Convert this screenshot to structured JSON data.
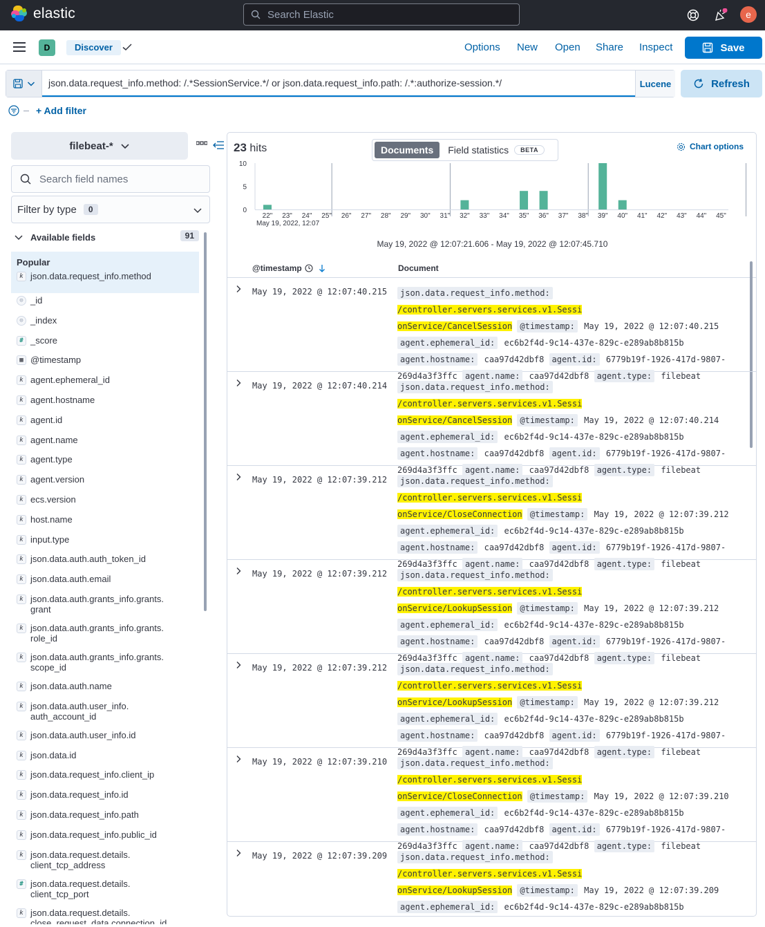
{
  "header": {
    "logo_text": "elastic",
    "search_placeholder": "Search Elastic",
    "avatar_letter": "e"
  },
  "appbar": {
    "space_letter": "D",
    "breadcrumb": "Discover",
    "menu": [
      "Options",
      "New",
      "Open",
      "Share",
      "Inspect"
    ],
    "save_label": "Save"
  },
  "query": {
    "value": "json.data.request_info.method: /.*SessionService.*/ or  json.data.request_info.path: /.*:authorize-session.*/",
    "language": "Lucene",
    "refresh_label": "Refresh",
    "add_filter_label": "+ Add filter"
  },
  "sidebar": {
    "index_pattern": "filebeat-*",
    "search_placeholder": "Search field names",
    "filter_by_type_label": "Filter by type",
    "filter_by_type_count": "0",
    "available_fields_label": "Available fields",
    "available_fields_count": "91",
    "popular_label": "Popular",
    "popular_fields": [
      {
        "type": "k",
        "name": "json.data.request_info.method"
      }
    ],
    "fields": [
      {
        "type": "id",
        "name": "_id"
      },
      {
        "type": "id",
        "name": "_index"
      },
      {
        "type": "#",
        "name": "_score"
      },
      {
        "type": "date",
        "name": "@timestamp"
      },
      {
        "type": "k",
        "name": "agent.ephemeral_id"
      },
      {
        "type": "k",
        "name": "agent.hostname"
      },
      {
        "type": "k",
        "name": "agent.id"
      },
      {
        "type": "k",
        "name": "agent.name"
      },
      {
        "type": "k",
        "name": "agent.type"
      },
      {
        "type": "k",
        "name": "agent.version"
      },
      {
        "type": "k",
        "name": "ecs.version"
      },
      {
        "type": "k",
        "name": "host.name"
      },
      {
        "type": "k",
        "name": "input.type"
      },
      {
        "type": "k",
        "name": "json.data.auth.auth_token_id"
      },
      {
        "type": "k",
        "name": "json.data.auth.email"
      },
      {
        "type": "k",
        "name": "json.data.auth.grants_info.grants.",
        "name2": "grant"
      },
      {
        "type": "k",
        "name": "json.data.auth.grants_info.grants.",
        "name2": "role_id"
      },
      {
        "type": "k",
        "name": "json.data.auth.grants_info.grants.",
        "name2": "scope_id"
      },
      {
        "type": "k",
        "name": "json.data.auth.name"
      },
      {
        "type": "k",
        "name": "json.data.auth.user_info.",
        "name2": "auth_account_id"
      },
      {
        "type": "k",
        "name": "json.data.auth.user_info.id"
      },
      {
        "type": "k",
        "name": "json.data.id"
      },
      {
        "type": "k",
        "name": "json.data.request_info.client_ip"
      },
      {
        "type": "k",
        "name": "json.data.request_info.id"
      },
      {
        "type": "k",
        "name": "json.data.request_info.path"
      },
      {
        "type": "k",
        "name": "json.data.request_info.public_id"
      },
      {
        "type": "k",
        "name": "json.data.request.details.",
        "name2": "client_tcp_address"
      },
      {
        "type": "#",
        "name": "json.data.request.details.",
        "name2": "client_tcp_port"
      },
      {
        "type": "k",
        "name": "json.data.request.details.",
        "name2": "close_request_data.connection_id"
      }
    ]
  },
  "main": {
    "hits_count": "23",
    "hits_label": "hits",
    "tabs": {
      "documents": "Documents",
      "field_statistics": "Field statistics",
      "beta": "BETA"
    },
    "chart_options_label": "Chart options",
    "time_range": "May 19, 2022 @ 12:07:21.606 - May 19, 2022 @ 12:07:45.710",
    "columns": {
      "timestamp": "@timestamp",
      "document": "Document"
    },
    "rows": [
      {
        "ts": "May 19, 2022 @ 12:07:40.215",
        "method_a": "/controller.servers.services.v1.Sessi",
        "method_b": "onService/CancelSession",
        "ts2": "May 19, 2022 @ 12:07:40.215"
      },
      {
        "ts": "May 19, 2022 @ 12:07:40.214",
        "method_a": "/controller.servers.services.v1.Sessi",
        "method_b": "onService/CancelSession",
        "ts2": "May 19, 2022 @ 12:07:40.214"
      },
      {
        "ts": "May 19, 2022 @ 12:07:39.212",
        "method_a": "/controller.servers.services.v1.Sessi",
        "method_b": "onService/CloseConnection",
        "ts2": "May 19, 2022 @ 12:07:39.212"
      },
      {
        "ts": "May 19, 2022 @ 12:07:39.212",
        "method_a": "/controller.servers.services.v1.Sessi",
        "method_b": "onService/LookupSession",
        "ts2": "May 19, 2022 @ 12:07:39.212"
      },
      {
        "ts": "May 19, 2022 @ 12:07:39.212",
        "method_a": "/controller.servers.services.v1.Sessi",
        "method_b": "onService/LookupSession",
        "ts2": "May 19, 2022 @ 12:07:39.212"
      },
      {
        "ts": "May 19, 2022 @ 12:07:39.210",
        "method_a": "/controller.servers.services.v1.Sessi",
        "method_b": "onService/CloseConnection",
        "ts2": "May 19, 2022 @ 12:07:39.210"
      },
      {
        "ts": "May 19, 2022 @ 12:07:39.209",
        "method_a": "/controller.servers.services.v1.Sessi",
        "method_b": "onService/LookupSession",
        "ts2": "May 19, 2022 @ 12:07:39.209"
      }
    ],
    "doc_common": {
      "k_method": "json.data.request_info.method:",
      "k_ts": "@timestamp:",
      "k_eph": "agent.ephemeral_id:",
      "v_eph": "ec6b2f4d-9c14-437e-829c-e289ab8b815b",
      "k_host": "agent.hostname:",
      "v_host": "caa97d42dbf8",
      "k_id": "agent.id:",
      "v_id_a": "6779b19f-1926-417d-9807-",
      "v_id_b": "269d4a3f3ffc",
      "k_name": "agent.name:",
      "v_name": "caa97d42dbf8",
      "k_type": "agent.type:",
      "v_type": "filebeat"
    }
  },
  "chart_data": {
    "type": "bar",
    "categories": [
      "22\"",
      "23\"",
      "24\"",
      "25\"",
      "26\"",
      "27\"",
      "28\"",
      "29\"",
      "30\"",
      "31\"",
      "32\"",
      "33\"",
      "34\"",
      "35\"",
      "36\"",
      "37\"",
      "38\"",
      "39\"",
      "40\"",
      "41\"",
      "42\"",
      "43\"",
      "44\"",
      "45\""
    ],
    "values": [
      1,
      0,
      0,
      0,
      0,
      0,
      0,
      0,
      0,
      0,
      2,
      0,
      0,
      4,
      4,
      0,
      0,
      10,
      2,
      0,
      0,
      0,
      0,
      0
    ],
    "yticks": [
      "10",
      "5",
      "0"
    ],
    "ylim": [
      0,
      10
    ],
    "date_label": "May 19, 2022, 12:07",
    "color": "#54b399"
  }
}
